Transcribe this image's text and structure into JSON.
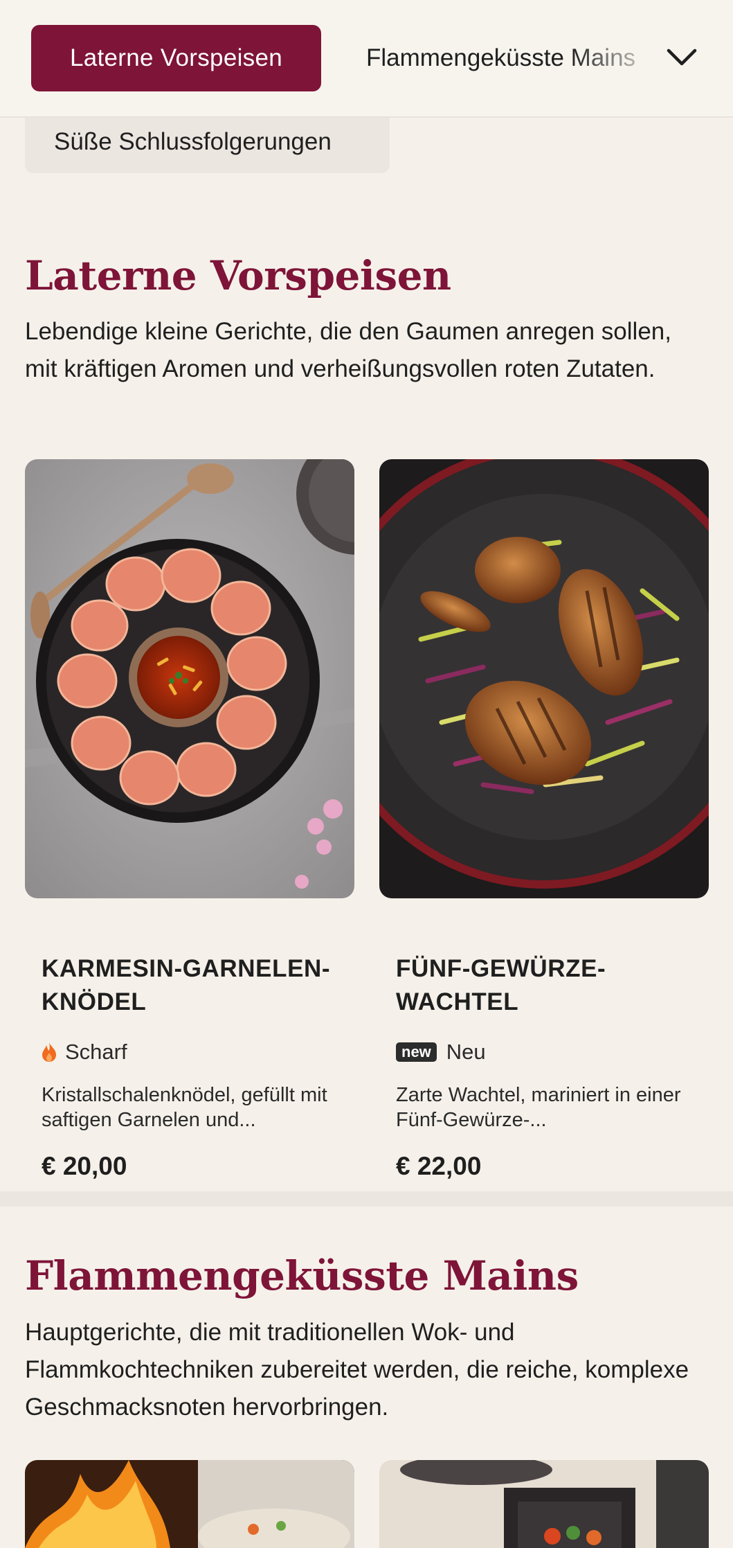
{
  "nav": {
    "active_label": "Laterne Vorspeisen",
    "next_label": "Flammengeküsste Mains",
    "overflow_label": "Süße Schlussfolgerungen",
    "chevron_icon": "chevron-down-icon"
  },
  "sections": [
    {
      "title": "Laterne Vorspeisen",
      "description": "Lebendige kleine Gerichte, die den Gaumen anregen sollen, mit kräftigen Aromen und verheißungsvollen roten Zutaten.",
      "items": [
        {
          "name": "KARMESIN-GARNELEN-KNÖDEL",
          "badge_icon": "flame-icon",
          "badge_label": "Scharf",
          "description": "Kristallschalenknödel, gefüllt mit saftigen Garnelen und...",
          "price": "€ 20,00"
        },
        {
          "name": "FÜNF-GEWÜRZE-WACHTEL",
          "badge_tag": "new",
          "badge_label": "Neu",
          "description": "Zarte Wachtel, mariniert in einer Fünf-Gewürze-...",
          "price": "€ 22,00"
        }
      ]
    },
    {
      "title": "Flammengeküsste Mains",
      "description": "Hauptgerichte, die mit traditionellen Wok- und Flammkochtechniken zubereitet werden, die reiche, komplexe Geschmacksnoten hervorbringen."
    }
  ],
  "colors": {
    "accent": "#7e1438",
    "background": "#f5f1ea",
    "pill": "#ece6e1"
  }
}
